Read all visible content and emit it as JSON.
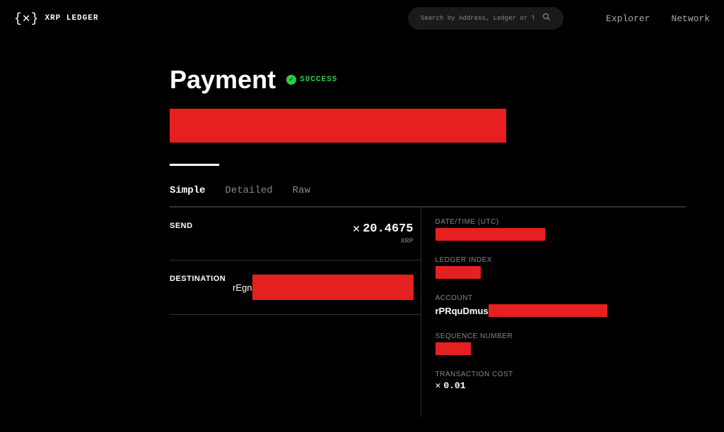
{
  "header": {
    "logo_text": "XRP LEDGER",
    "search_placeholder": "Search by Address, Ledger or Txn",
    "nav": {
      "explorer": "Explorer",
      "network": "Network"
    }
  },
  "page": {
    "title": "Payment",
    "status": "SUCCESS"
  },
  "tabs": {
    "simple": "Simple",
    "detailed": "Detailed",
    "raw": "Raw"
  },
  "details": {
    "send_label": "SEND",
    "send_amount": "20.4675",
    "send_currency": "XRP",
    "destination_label": "DESTINATION",
    "destination_prefix": "rEgn"
  },
  "meta": {
    "datetime_label": "DATE/TIME (UTC)",
    "ledger_label": "LEDGER INDEX",
    "account_label": "ACCOUNT",
    "account_prefix": "rPRquDmus",
    "sequence_label": "SEQUENCE NUMBER",
    "cost_label": "TRANSACTION COST",
    "cost_value": "0.01"
  }
}
